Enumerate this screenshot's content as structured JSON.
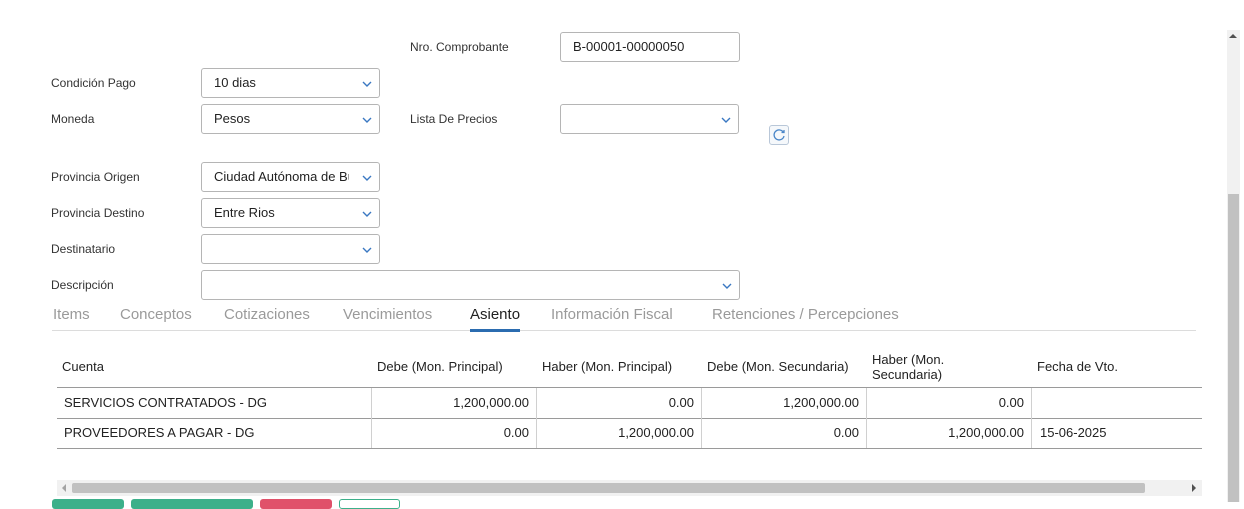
{
  "form": {
    "nro_comprobante": {
      "label": "Nro. Comprobante",
      "value": "B-00001-00000050"
    },
    "condicion_pago": {
      "label": "Condición Pago",
      "value": "10 dias"
    },
    "moneda": {
      "label": "Moneda",
      "value": "Pesos"
    },
    "lista_precios": {
      "label": "Lista De Precios",
      "value": ""
    },
    "provincia_origen": {
      "label": "Provincia Origen",
      "value": "Ciudad Autónoma de Buenos Aires"
    },
    "provincia_destino": {
      "label": "Provincia Destino",
      "value": "Entre Rios"
    },
    "destinatario": {
      "label": "Destinatario",
      "value": ""
    },
    "descripcion": {
      "label": "Descripción",
      "value": ""
    }
  },
  "tabs": [
    {
      "label": "Items"
    },
    {
      "label": "Conceptos"
    },
    {
      "label": "Cotizaciones"
    },
    {
      "label": "Vencimientos"
    },
    {
      "label": "Asiento",
      "active": true
    },
    {
      "label": "Información Fiscal"
    },
    {
      "label": "Retenciones / Percepciones"
    }
  ],
  "table": {
    "headers": [
      "Cuenta",
      "Debe (Mon. Principal)",
      "Haber (Mon. Principal)",
      "Debe (Mon. Secundaria)",
      "Haber (Mon. Secundaria)",
      "Fecha de Vto."
    ],
    "rows": [
      [
        "SERVICIOS CONTRATADOS - DG",
        "1,200,000.00",
        "0.00",
        "1,200,000.00",
        "0.00",
        ""
      ],
      [
        "PROVEEDORES A PAGAR - DG",
        "0.00",
        "1,200,000.00",
        "0.00",
        "1,200,000.00",
        "15-06-2025"
      ]
    ]
  },
  "icons": {
    "dropdown": "chevron-down-icon",
    "refresh": "refresh-icon",
    "scroll_left": "arrow-left-icon",
    "scroll_right": "arrow-right-icon",
    "scroll_up": "arrow-up-icon"
  },
  "colors": {
    "accent": "#2b6cb0",
    "tab_inactive": "#9a9a9a",
    "button_green": "#3cb08a",
    "button_red": "#e0516a"
  }
}
